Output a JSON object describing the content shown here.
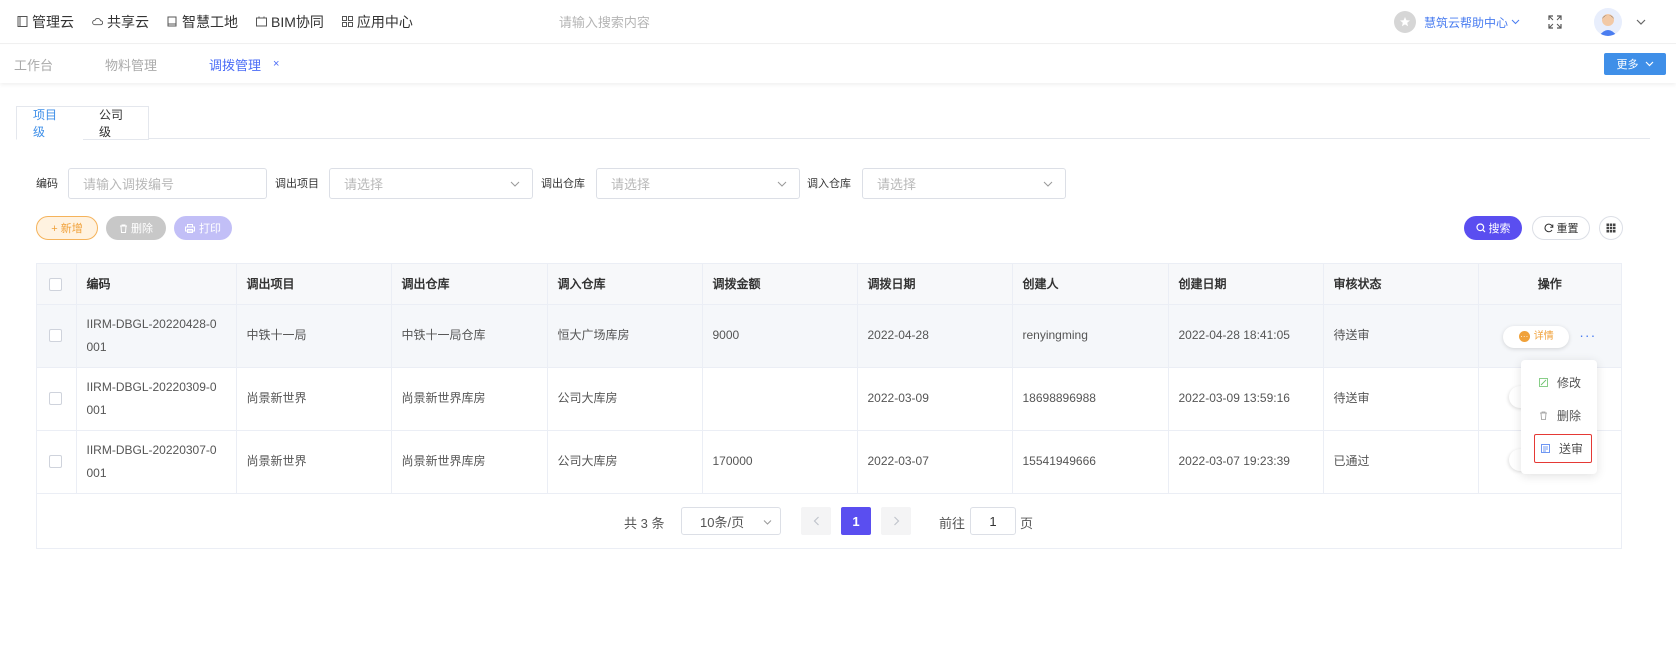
{
  "topnav": {
    "items": [
      {
        "label": "管理云",
        "icon": "book-icon"
      },
      {
        "label": "共享云",
        "icon": "cloud-icon"
      },
      {
        "label": "智慧工地",
        "icon": "building-icon"
      },
      {
        "label": "BIM协同",
        "icon": "bim-icon"
      },
      {
        "label": "应用中心",
        "icon": "apps-grid-icon"
      }
    ],
    "search_placeholder": "请输入搜索内容",
    "help_label": "慧筑云帮助中心"
  },
  "tabs": {
    "items": [
      "工作台",
      "物料管理",
      "调拨管理"
    ],
    "active_index": 2,
    "close_glyph": "×",
    "more_label": "更多"
  },
  "level_tabs": [
    "项目级",
    "公司级"
  ],
  "filters": {
    "code_label": "编码",
    "code_placeholder": "请输入调拨编号",
    "out_project_label": "调出项目",
    "out_project_placeholder": "请选择",
    "out_warehouse_label": "调出仓库",
    "out_warehouse_placeholder": "请选择",
    "in_warehouse_label": "调入仓库",
    "in_warehouse_placeholder": "请选择"
  },
  "actions": {
    "add": "+ 新增",
    "delete": "删除",
    "print": "打印",
    "search": "搜索",
    "reset": "重置"
  },
  "table": {
    "columns": [
      "编码",
      "调出项目",
      "调出仓库",
      "调入仓库",
      "调拨金额",
      "调拨日期",
      "创建人",
      "创建日期",
      "审核状态",
      "操作"
    ],
    "rows": [
      {
        "code_line1": "IIRM-DBGL-20220428-0",
        "code_line2": "001",
        "out_project": "中铁十一局",
        "out_warehouse": "中铁十一局仓库",
        "in_warehouse": "恒大广场库房",
        "amount": "9000",
        "date": "2022-04-28",
        "creator": "renyingming",
        "created": "2022-04-28 18:41:05",
        "status": "待送审"
      },
      {
        "code_line1": "IIRM-DBGL-20220309-0",
        "code_line2": "001",
        "out_project": "尚景新世界",
        "out_warehouse": "尚景新世界库房",
        "in_warehouse": "公司大库房",
        "amount": "",
        "date": "2022-03-09",
        "creator": "18698896988",
        "created": "2022-03-09 13:59:16",
        "status": "待送审"
      },
      {
        "code_line1": "IIRM-DBGL-20220307-0",
        "code_line2": "001",
        "out_project": "尚景新世界",
        "out_warehouse": "尚景新世界库房",
        "in_warehouse": "公司大库房",
        "amount": "170000",
        "date": "2022-03-07",
        "creator": "15541949666",
        "created": "2022-03-07 19:23:39",
        "status": "已通过"
      }
    ],
    "detail_label": "详情",
    "more_glyph": "···"
  },
  "dropdown": {
    "items": [
      {
        "label": "修改",
        "icon": "edit-icon"
      },
      {
        "label": "删除",
        "icon": "trash-icon"
      },
      {
        "label": "送审",
        "icon": "submit-review-icon"
      }
    ]
  },
  "pagination": {
    "total_text": "共 3 条",
    "page_size": "10条/页",
    "current_page": "1",
    "goto_label": "前往",
    "goto_value": "1",
    "page_unit": "页"
  },
  "colors": {
    "primary": "#5a4ef0",
    "link": "#4b6cf6",
    "more_button": "#3f8fe8",
    "add_accent": "#f0a13a",
    "highlight_border": "#e53935"
  }
}
